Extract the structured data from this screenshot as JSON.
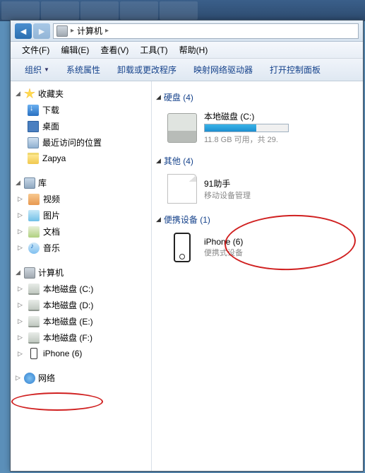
{
  "breadcrumb": {
    "root": "计算机"
  },
  "menubar": [
    "文件(F)",
    "编辑(E)",
    "查看(V)",
    "工具(T)",
    "帮助(H)"
  ],
  "toolbar": {
    "organize": "组织",
    "props": "系统属性",
    "uninstall": "卸载或更改程序",
    "netdrv": "映射网络驱动器",
    "cpanel": "打开控制面板"
  },
  "sidebar": {
    "favorites": {
      "label": "收藏夹",
      "items": [
        "下载",
        "桌面",
        "最近访问的位置",
        "Zapya"
      ]
    },
    "libraries": {
      "label": "库",
      "items": [
        "视频",
        "图片",
        "文档",
        "音乐"
      ]
    },
    "computer": {
      "label": "计算机",
      "items": [
        "本地磁盘 (C:)",
        "本地磁盘 (D:)",
        "本地磁盘 (E:)",
        "本地磁盘 (F:)",
        "iPhone (6)"
      ]
    },
    "network": {
      "label": "网络"
    }
  },
  "main": {
    "hdd": {
      "header": "硬盘 (4)",
      "item": {
        "name": "本地磁盘 (C:)",
        "capacity": "11.8 GB 可用，共 29.",
        "fillPct": 62
      }
    },
    "other": {
      "header": "其他 (4)",
      "item": {
        "name": "91助手",
        "sub": "移动设备管理"
      }
    },
    "portable": {
      "header": "便携设备 (1)",
      "item": {
        "name": "iPhone (6)",
        "sub": "便携式设备"
      }
    }
  }
}
